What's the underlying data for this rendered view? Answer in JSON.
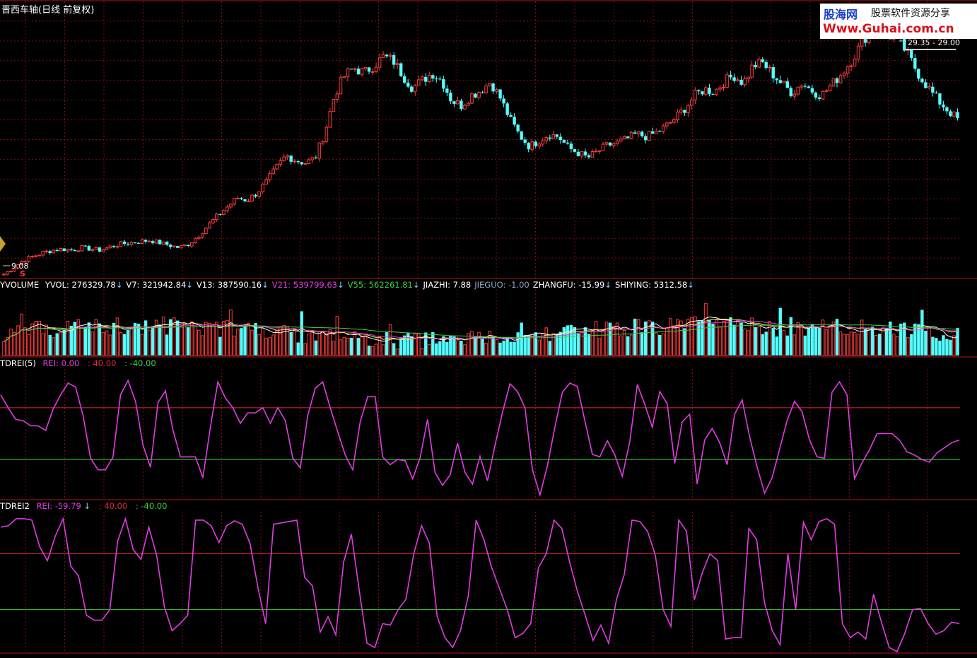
{
  "window": {
    "title": "晋西车轴(日线 前复权)"
  },
  "watermark": {
    "brand": "股海网",
    "slogan": "股票软件资源分享",
    "url": "Www.Guhai.com.cn"
  },
  "price_panel": {
    "high_label": "29.35 - 29.00",
    "low_label": "9.08",
    "marker": "S"
  },
  "volume_panel": {
    "indicator": "YVOLUME",
    "items": [
      {
        "label": "YVOL: 276329.78",
        "arrow": "↓",
        "color": "#ffffff"
      },
      {
        "label": "V7: 321942.84",
        "arrow": "↓",
        "color": "#ffffff"
      },
      {
        "label": "V13: 387590.16",
        "arrow": "↓",
        "color": "#ffffff"
      },
      {
        "label": "V21: 539799.63",
        "arrow": "↓",
        "color": "#e23be2"
      },
      {
        "label": "V55: 562261.81",
        "arrow": "↓",
        "color": "#39d339"
      },
      {
        "label": "JIAZHI: 7.88",
        "arrow": "",
        "color": "#ffffff"
      },
      {
        "label": "JIEGUO: -1.00",
        "arrow": "",
        "color": "#8aa7c7"
      },
      {
        "label": "ZHANGFU: -15.99",
        "arrow": "↓",
        "color": "#ffffff"
      },
      {
        "label": "SHIYING: 5312.58",
        "arrow": "↓",
        "color": "#ffffff"
      }
    ]
  },
  "rei_panel_1": {
    "indicator": "TDREI(5)",
    "rei_label": "REI: 0.00",
    "rei_arrow": "",
    "upper_label": ": 40.00",
    "lower_label": ": -40.00"
  },
  "rei_panel_2": {
    "indicator": "TDREI2",
    "rei_label": "REI: -59.79",
    "rei_arrow": "↓",
    "upper_label": ": 40.00",
    "lower_label": ": -40.00"
  },
  "colors": {
    "up": "#ff3c3c",
    "down": "#54ffff",
    "rei_line": "#e33be3",
    "upper_line": "#e0283c",
    "lower_line": "#3ad23a",
    "grid": "#7a1010",
    "panel_border": "#b01818"
  },
  "chart_data": [
    {
      "type": "candlestick",
      "ylim": [
        9.08,
        29.35
      ],
      "price_path": [
        9.08,
        9.6,
        10.2,
        10.5,
        10.8,
        11.0,
        11.1,
        11.0,
        11.2,
        11.1,
        11.0,
        11.3,
        11.5,
        11.6,
        11.7,
        11.8,
        11.6,
        11.4,
        11.2,
        11.5,
        12.2,
        13.0,
        13.8,
        14.5,
        15.2,
        15.0,
        15.6,
        16.5,
        17.6,
        18.6,
        18.2,
        18.0,
        18.4,
        20.5,
        23.5,
        25.0,
        25.6,
        25.2,
        25.8,
        26.5,
        26.2,
        25.0,
        24.0,
        24.6,
        25.2,
        24.6,
        23.0,
        22.6,
        23.4,
        23.8,
        24.5,
        23.2,
        21.5,
        20.2,
        19.3,
        19.8,
        20.3,
        20.1,
        19.2,
        18.8,
        18.4,
        18.9,
        19.4,
        19.6,
        19.9,
        20.3,
        20.1,
        20.4,
        20.9,
        21.6,
        22.4,
        23.4,
        23.9,
        23.7,
        24.5,
        25.0,
        24.4,
        25.8,
        26.0,
        25.1,
        24.3,
        23.6,
        24.4,
        23.8,
        23.4,
        24.2,
        25.1,
        26.1,
        27.4,
        28.7,
        29.0,
        28.2,
        27.8,
        26.5,
        25.1,
        24.0,
        23.0,
        22.2,
        21.5
      ]
    },
    {
      "type": "bar",
      "name": "YVOLUME",
      "values": [
        276329.78,
        321942.84,
        387590.16,
        539799.63,
        562261.81
      ]
    },
    {
      "type": "line",
      "name": "TDREI(5)",
      "ylim": [
        -100,
        100
      ],
      "reference_lines": [
        40,
        -40
      ],
      "values": [
        60,
        40,
        22,
        20,
        12,
        12,
        5,
        38,
        60,
        78,
        72,
        28,
        -38,
        -56,
        -56,
        -36,
        60,
        82,
        50,
        -18,
        -52,
        48,
        66,
        5,
        -36,
        -36,
        -36,
        -68,
        10,
        80,
        55,
        40,
        16,
        32,
        32,
        40,
        16,
        40,
        20,
        -38,
        -53,
        28,
        70,
        80,
        40,
        3,
        -33,
        -56,
        18,
        57,
        57,
        -36,
        -48,
        -40,
        -42,
        -70,
        -37,
        22,
        -60,
        -80,
        -64,
        -15,
        -60,
        -78,
        -35,
        -73,
        -18,
        33,
        77,
        65,
        40,
        -56,
        -95,
        -50,
        10,
        64,
        78,
        73,
        20,
        -32,
        -36,
        -11,
        -33,
        -66,
        -12,
        76,
        45,
        10,
        65,
        46,
        -46,
        18,
        30,
        -78,
        -10,
        8,
        -14,
        -48,
        30,
        52,
        -5,
        -52,
        -92,
        -68,
        -24,
        20,
        50,
        34,
        -10,
        -36,
        -38,
        64,
        80,
        60,
        -70,
        -45,
        -25,
        0,
        0,
        0,
        -10,
        -28,
        -33,
        -40,
        -44,
        -30,
        -22,
        -14,
        -10
      ]
    },
    {
      "type": "line",
      "name": "TDREI2",
      "ylim": [
        -100,
        100
      ],
      "reference_lines": [
        40,
        -40
      ],
      "values": [
        78,
        80,
        90,
        90,
        88,
        50,
        30,
        65,
        90,
        22,
        8,
        -48,
        -55,
        -55,
        -40,
        58,
        90,
        46,
        32,
        78,
        38,
        -36,
        -70,
        -60,
        -48,
        88,
        88,
        80,
        56,
        80,
        87,
        82,
        54,
        -8,
        -60,
        82,
        84,
        86,
        88,
        6,
        -6,
        -72,
        -50,
        -76,
        28,
        68,
        -12,
        -88,
        -94,
        -60,
        -62,
        -40,
        -25,
        40,
        80,
        55,
        -50,
        -80,
        -94,
        -70,
        -20,
        88,
        60,
        20,
        -10,
        -40,
        -80,
        -74,
        -60,
        20,
        40,
        88,
        76,
        28,
        -14,
        -48,
        -84,
        -62,
        -88,
        -26,
        10,
        88,
        86,
        72,
        38,
        -40,
        -64,
        88,
        72,
        -26,
        12,
        40,
        30,
        -82,
        -80,
        -80,
        76,
        60,
        -30,
        -70,
        -90,
        40,
        -40,
        85,
        60,
        86,
        90,
        82,
        -60,
        -80,
        -72,
        -82,
        -18,
        -58,
        -94,
        -100,
        -74,
        -40,
        -38,
        -60,
        -75,
        -70,
        -58,
        -60
      ]
    }
  ]
}
